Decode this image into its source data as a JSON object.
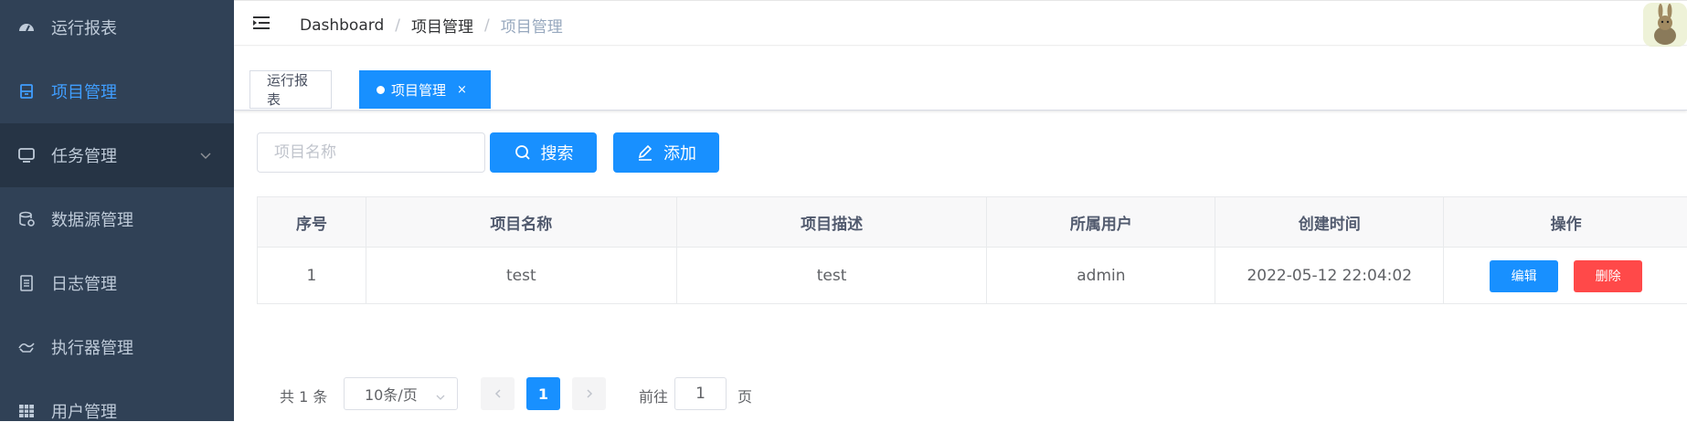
{
  "sidebar": {
    "items": [
      {
        "label": "运行报表",
        "icon": "dashboard-icon"
      },
      {
        "label": "项目管理",
        "icon": "project-icon",
        "active": true
      },
      {
        "label": "任务管理",
        "icon": "monitor-icon",
        "expandable": true
      },
      {
        "label": "数据源管理",
        "icon": "database-icon"
      },
      {
        "label": "日志管理",
        "icon": "log-icon"
      },
      {
        "label": "执行器管理",
        "icon": "executor-icon"
      },
      {
        "label": "用户管理",
        "icon": "user-table-icon"
      }
    ]
  },
  "navbar": {
    "breadcrumb": [
      "Dashboard",
      "项目管理",
      "项目管理"
    ]
  },
  "tags": [
    {
      "label": "运行报表",
      "active": false
    },
    {
      "label": "项目管理",
      "active": true,
      "close": "×"
    }
  ],
  "toolbar": {
    "search_placeholder": "项目名称",
    "search_label": "搜索",
    "add_label": "添加"
  },
  "table": {
    "headers": [
      "序号",
      "项目名称",
      "项目描述",
      "所属用户",
      "创建时间",
      "操作"
    ],
    "rows": [
      {
        "index": "1",
        "name": "test",
        "description": "test",
        "user": "admin",
        "created": "2022-05-12 22:04:02"
      }
    ],
    "edit_label": "编辑",
    "delete_label": "删除"
  },
  "pagination": {
    "total": "共 1 条",
    "page_size": "10条/页",
    "current_page": "1",
    "goto_prefix": "前往",
    "goto_value": "1",
    "goto_suffix": "页"
  },
  "colors": {
    "sidebar_bg": "#304156",
    "primary": "#1890ff",
    "danger": "#ff4949"
  }
}
